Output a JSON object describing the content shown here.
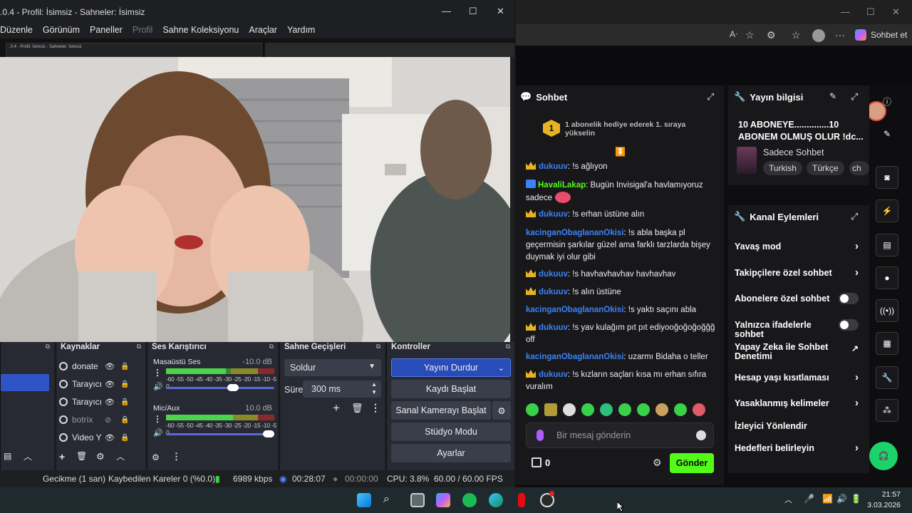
{
  "obs": {
    "title": ".0.4 - Profil: İsimsiz - Sahneler: İsimsiz",
    "nested_title": ".0.4 - Profil: İsimsiz - Sahneler: İsimsiz",
    "menu": [
      {
        "label": "Düzenle",
        "dim": false
      },
      {
        "label": "Görünüm",
        "dim": false
      },
      {
        "label": "Paneller",
        "dim": false
      },
      {
        "label": "Profil",
        "dim": true
      },
      {
        "label": "Sahne Koleksiyonu",
        "dim": false
      },
      {
        "label": "Araçlar",
        "dim": false
      },
      {
        "label": "Yardım",
        "dim": false
      }
    ],
    "docks": {
      "sources_title": "Kaynaklar",
      "mixer_title": "Ses Karıştırıcı",
      "transitions_title": "Sahne Geçişleri",
      "controls_title": "Kontroller"
    },
    "sources": [
      {
        "name": "donate",
        "hidden": false
      },
      {
        "name": "Tarayıcı",
        "hidden": false
      },
      {
        "name": "Tarayıcı",
        "hidden": false
      },
      {
        "name": "botrix",
        "hidden": true
      },
      {
        "name": "Video Y",
        "hidden": false
      }
    ],
    "mixer": [
      {
        "name": "Masaüstü Ses",
        "db": "-10.0 dB",
        "level": 0.55,
        "volume": 0.62
      },
      {
        "name": "Mic/Aux",
        "db": "10.0 dB",
        "level": 0.62,
        "volume": 0.95
      }
    ],
    "meter_ticks": "-60 -55 -50 -45 -40 -35 -30 -25 -20 -15 -10  -5   0",
    "transition": {
      "type": "Soldur",
      "duration_label": "Süre",
      "duration": "300 ms"
    },
    "controls": [
      "Yayını Durdur",
      "Kaydı Başlat",
      "Sanal Kamerayı Başlat",
      "Stüdyo Modu",
      "Ayarlar"
    ],
    "status": {
      "delay": "Gecikme (1 san)",
      "dropped": "Kaybedilen Kareler 0 (%0.0)",
      "bitrate": "6989 kbps",
      "live_time": "00:28:07",
      "rec_time": "00:00:00",
      "cpu": "CPU: 3.8%",
      "fps": "60.00 / 60.00 FPS"
    }
  },
  "browser": {
    "copilot_label": "Sohbet et",
    "chat_title": "Sohbet",
    "pinned": {
      "rank": "1",
      "text": "1 abonelik hediye ederek 1. sıraya yükselin"
    },
    "messages": [
      {
        "user": "dukuuv",
        "badge": "crown",
        "color": "#3b82f6",
        "text": ": !s ağlıyon"
      },
      {
        "user": "HavaliLakap",
        "badge": "kick",
        "color": "#53fc18",
        "text": ": Bugün Invisigal'a havlamıyoruz sadece"
      },
      {
        "user": "dukuuv",
        "badge": "crown",
        "color": "#3b82f6",
        "text": ": !s erhan üstüne alın"
      },
      {
        "user": "kacinganObaglananOkisi",
        "badge": "none",
        "color": "#3b82f6",
        "text": ": !s abla başka pl geçermisin şarkılar güzel ama farklı tarzlarda bişey duymak iyi olur gibi"
      },
      {
        "user": "dukuuv",
        "badge": "crown",
        "color": "#3b82f6",
        "text": ": !s havhavhavhav havhavhav"
      },
      {
        "user": "dukuuv",
        "badge": "crown",
        "color": "#3b82f6",
        "text": ": !s alın üstüne"
      },
      {
        "user": "kacinganObaglananOkisi",
        "badge": "none",
        "color": "#3b82f6",
        "text": ": !s yaktı saçını abla"
      },
      {
        "user": "dukuuv",
        "badge": "crown",
        "color": "#3b82f6",
        "text": ": !s yav kulağım pıt pıt ediyooğoğoğoğğğ off"
      },
      {
        "user": "kacinganObaglananOkisi",
        "badge": "none",
        "color": "#3b82f6",
        "text": ": uzarmı Bidaha o teller"
      },
      {
        "user": "dukuuv",
        "badge": "crown",
        "color": "#3b82f6",
        "text": ": !s kızların saçları kısa mı erhan sıfıra vuralım"
      }
    ],
    "input_placeholder": "Bir mesaj gönderin",
    "gift_count": "0",
    "send_label": "Gönder",
    "stream_info": {
      "title": "Yayın bilgisi",
      "stream_title": "10 ABONEYE..............10 ABONEM OLMUŞ OLUR !dc...",
      "category": "Sadece Sohbet",
      "tags": [
        "Turkish",
        "Türkçe",
        "ch"
      ]
    },
    "channel_actions": {
      "title": "Kanal Eylemleri",
      "items": [
        {
          "label": "Yavaş mod",
          "control": "chevron"
        },
        {
          "label": "Takipçilere özel sohbet",
          "control": "chevron"
        },
        {
          "label": "Abonelere özel sohbet",
          "control": "toggle"
        },
        {
          "label": "Yalnızca ifadelerle sohbet",
          "control": "toggle"
        },
        {
          "label": "Yapay Zeka ile Sohbet Denetimi",
          "control": "external"
        },
        {
          "label": "Hesap yaşı kısıtlaması",
          "control": "chevron"
        },
        {
          "label": "Yasaklanmış kelimeler",
          "control": "chevron"
        },
        {
          "label": "İzleyici Yönlendir",
          "control": "none"
        },
        {
          "label": "Hedefleri belirleyin",
          "control": "chevron"
        }
      ]
    },
    "rail_icons": [
      "info-icon",
      "pencil-icon",
      "camera-icon",
      "bolt-icon",
      "notes-icon",
      "chat-bubble-icon",
      "broadcast-icon",
      "layout-icon",
      "wrench-icon",
      "apps-icon"
    ]
  },
  "taskbar": {
    "time": "21:57",
    "date": "3.03.2026"
  },
  "colors": {
    "kick_green": "#53fc18",
    "obs_blue": "#284cb8",
    "crown": "#e6b422"
  }
}
